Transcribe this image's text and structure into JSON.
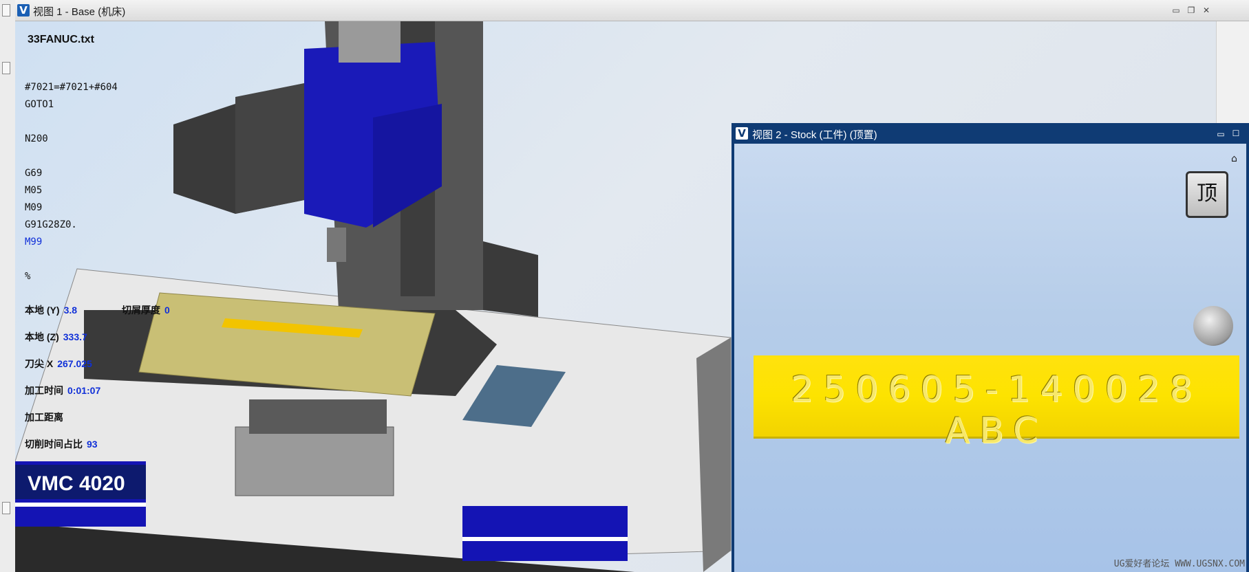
{
  "view1": {
    "title": "视图 1 - Base (机床)",
    "buttons": {
      "minimize": "▭",
      "restore": "❐",
      "close": "✕"
    }
  },
  "nc_program": {
    "filename": "33FANUC.txt",
    "lines": [
      "#7021=#7021+#604",
      "GOTO1",
      "",
      "N200",
      "",
      "G69",
      "M05",
      "M09",
      "G91G28Z0.",
      "M99",
      "",
      "%"
    ],
    "current_line": "M99",
    "colors": {
      "text": "#111111",
      "current": "#1030d8"
    }
  },
  "status": {
    "local_y": {
      "label": "本地 (Y)",
      "value": "3.8"
    },
    "chip_thickness": {
      "label": "切屑厚度",
      "value": "0"
    },
    "local_z": {
      "label": "本地 (Z)",
      "value": "333.7"
    },
    "tool_tip_x": {
      "label": "刀尖 X",
      "value": "267.025"
    },
    "machining_time": {
      "label": "加工时间",
      "value": "0:01:07"
    },
    "machining_distance": {
      "label": "加工距离",
      "value": ""
    },
    "cutting_time_ratio": {
      "label": "切削时间占比",
      "value": "93"
    }
  },
  "machine": {
    "label": "VMC 4020"
  },
  "view2": {
    "title": "视图 2 - Stock (工件) (顶置)",
    "buttons": {
      "minimize": "▭",
      "maximize": "☐"
    },
    "cube_label": "顶",
    "engraving": "250605-140028 ABC"
  },
  "watermark": "UG爱好者论坛 WWW.UGSNX.COM",
  "colors": {
    "title_active": "#0f3b74",
    "value_blue": "#1030d8",
    "stock_yellow": "#fde300",
    "machine_blue": "#1414b4",
    "spindle_blue": "#1a1ab8"
  }
}
